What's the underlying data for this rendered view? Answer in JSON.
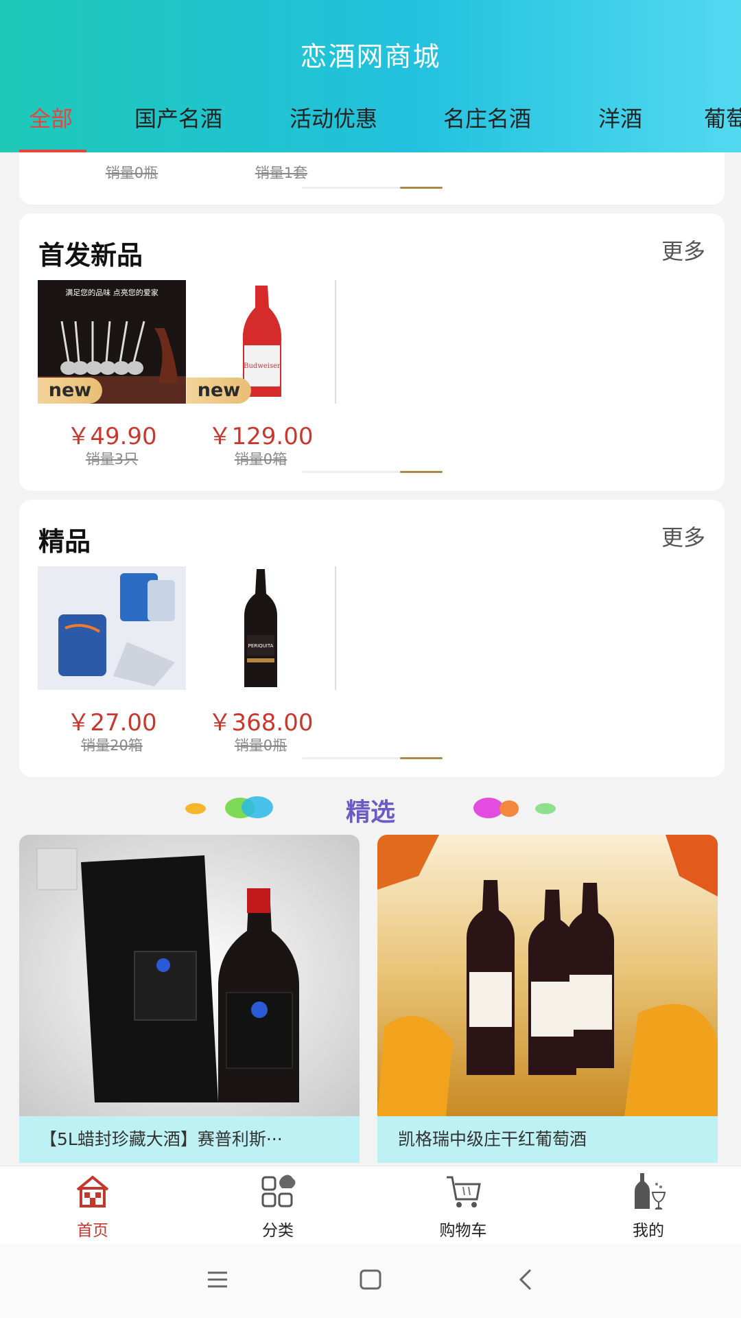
{
  "header": {
    "title": "恋酒网商城"
  },
  "tabs": [
    {
      "label": "全部",
      "active": true
    },
    {
      "label": "国产名酒"
    },
    {
      "label": "活动优惠"
    },
    {
      "label": "名庄名酒"
    },
    {
      "label": "洋酒"
    },
    {
      "label": "葡萄"
    }
  ],
  "top_card": {
    "items": [
      {
        "sales": "销量0瓶"
      },
      {
        "sales": "销量1套"
      }
    ]
  },
  "sections": [
    {
      "title": "首发新品",
      "more": "更多",
      "badge": "new",
      "items": [
        {
          "price": "￥49.90",
          "sales": "销量3只",
          "badge": "new"
        },
        {
          "price": "￥129.00",
          "sales": "销量0箱",
          "badge": "new"
        }
      ]
    },
    {
      "title": "精品",
      "more": "更多",
      "items": [
        {
          "price": "￥27.00",
          "sales": "销量20箱"
        },
        {
          "price": "￥368.00",
          "sales": "销量0瓶"
        }
      ]
    }
  ],
  "featured": {
    "title": "精选",
    "items": [
      {
        "caption": "【5L蜡封珍藏大酒】赛普利斯···"
      },
      {
        "caption": "凯格瑞中级庄干红葡萄酒"
      }
    ]
  },
  "bottom_nav": [
    {
      "label": "首页",
      "icon": "home-icon",
      "active": true
    },
    {
      "label": "分类",
      "icon": "category-icon"
    },
    {
      "label": "购物车",
      "icon": "cart-icon"
    },
    {
      "label": "我的",
      "icon": "profile-icon"
    }
  ],
  "colors": {
    "accent": "#e8443e",
    "price": "#c8382f",
    "header_start": "#1ec9b8",
    "header_end": "#52d9f0"
  }
}
